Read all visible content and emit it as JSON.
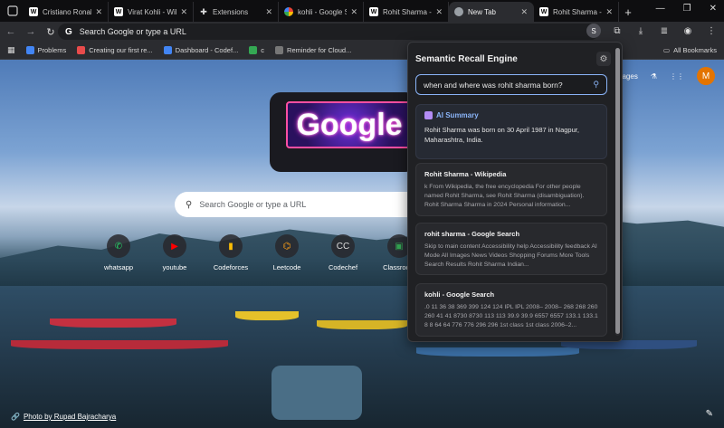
{
  "tabs": [
    {
      "title": "Cristiano Ronaldo",
      "favicon": "W",
      "type": "wiki"
    },
    {
      "title": "Virat Kohli - Wikip",
      "favicon": "W",
      "type": "wiki"
    },
    {
      "title": "Extensions",
      "favicon": "puzzle",
      "type": "ext"
    },
    {
      "title": "kohli - Google Se",
      "favicon": "G",
      "type": "google"
    },
    {
      "title": "Rohit Sharma - W",
      "favicon": "W",
      "type": "wiki"
    },
    {
      "title": "New Tab",
      "favicon": "chrome",
      "type": "chrome",
      "active": true
    },
    {
      "title": "Rohit Sharma - W",
      "favicon": "W",
      "type": "wiki"
    }
  ],
  "omnibox": {
    "placeholder": "Search Google or type a URL"
  },
  "extension_badge": "S",
  "bookmarks": [
    {
      "label": "Problems",
      "color": "#4285f4"
    },
    {
      "label": "Creating our first re...",
      "color": "#e84b4b"
    },
    {
      "label": "Dashboard - Codef...",
      "color": "#4285f4"
    },
    {
      "label": "c",
      "color": "#34a853"
    },
    {
      "label": "Reminder for Cloud...",
      "color": "#777777"
    }
  ],
  "all_bookmarks": "All Bookmarks",
  "ntp": {
    "images_link": "Images",
    "avatar_letter": "M",
    "doodle_text": "Google",
    "search_placeholder": "Search Google or type a URL",
    "shortcuts": [
      {
        "label": "whatsapp",
        "glyph": "✆",
        "color": "#25d366"
      },
      {
        "label": "youtube",
        "glyph": "▶",
        "color": "#ff0000"
      },
      {
        "label": "Codeforces",
        "glyph": "▮",
        "color": "#fbbc05"
      },
      {
        "label": "Leetcode",
        "glyph": "⌬",
        "color": "#ffa116"
      },
      {
        "label": "Codechef",
        "glyph": "CC",
        "color": "#dddddd"
      },
      {
        "label": "Classroom",
        "glyph": "▣",
        "color": "#34a853"
      }
    ],
    "photo_credit": "Photo by Rupad Bajracharya"
  },
  "popup": {
    "title": "Semantic Recall Engine",
    "query": "when and where was rohit sharma born?",
    "ai_summary": {
      "heading": "AI Summary",
      "text": "Rohit Sharma was born on 30 April 1987 in Nagpur, Maharashtra, India."
    },
    "results": [
      {
        "title": "Rohit Sharma - Wikipedia",
        "snippet": "k From Wikipedia, the free encyclopedia For other people named Rohit Sharma, see Rohit Sharma (disambiguation). Rohit Sharma Sharma in 2024 Personal information..."
      },
      {
        "title": "rohit sharma - Google Search",
        "snippet": "Skip to main content Accessibility help Accessibility feedback AI Mode All Images News Videos Shopping Forums More Tools Search Results Rohit Sharma Indian..."
      },
      {
        "title": "kohli - Google Search",
        "snippet": ".0 11 36 38 369 399 124 124 IPL IPL 2008– 2008– 268 268 260 260 41 41 8730 8730 113 113 39.9 39.9 6557 6557 133.1 133.1 8 8 64 64 776 776 296 296 1st class 1st class 2006–2..."
      }
    ]
  },
  "colors": {
    "accent": "#8ab4f8",
    "popup_bg": "#202124"
  }
}
